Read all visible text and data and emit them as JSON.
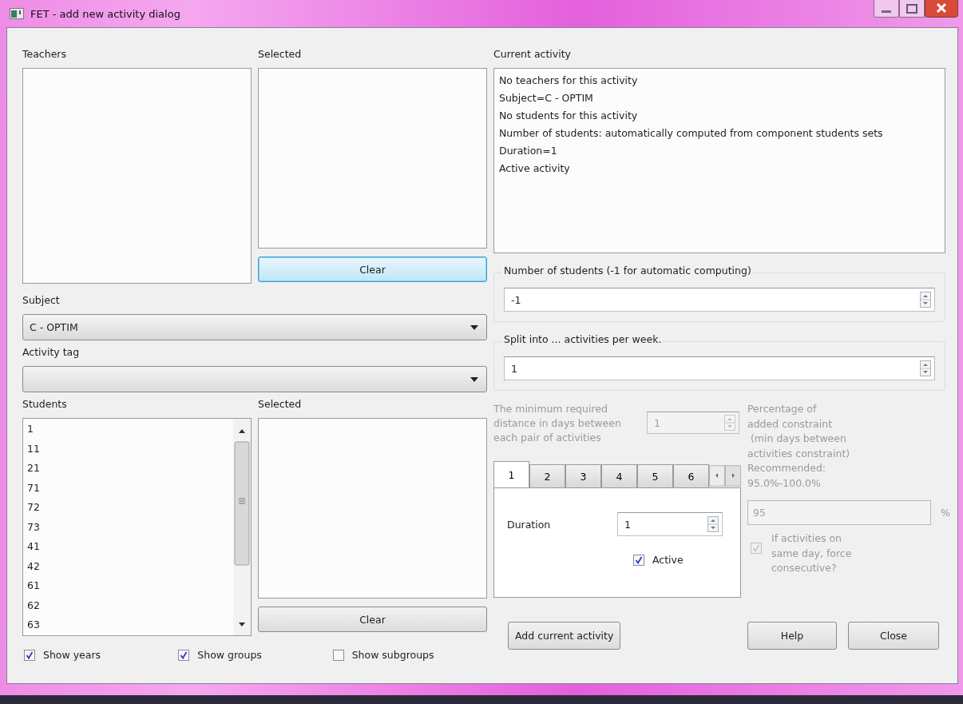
{
  "window": {
    "title": "FET - add new activity dialog"
  },
  "teachers": {
    "label": "Teachers",
    "selected_label": "Selected",
    "clear": "Clear"
  },
  "subject": {
    "label": "Subject",
    "value": "C - OPTIM"
  },
  "activity_tag": {
    "label": "Activity tag"
  },
  "students": {
    "label": "Students",
    "selected_label": "Selected",
    "clear": "Clear",
    "items": [
      "1",
      "11",
      "21",
      "71",
      "72",
      "73",
      "41",
      "42",
      "61",
      "62",
      "63"
    ]
  },
  "show_options": [
    {
      "label": "Show years",
      "checked": true
    },
    {
      "label": "Show groups",
      "checked": true
    },
    {
      "label": "Show subgroups",
      "checked": false
    }
  ],
  "current_activity": {
    "label": "Current activity",
    "lines": [
      "No teachers for this activity",
      "Subject=C - OPTIM",
      "No students for this activity",
      "Number of students: automatically computed from component students sets",
      "Duration=1",
      "Active activity"
    ]
  },
  "number_of_students": {
    "label": "Number of students (-1 for automatic computing)",
    "value": "-1"
  },
  "split": {
    "label": "Split into ... activities per week.",
    "value": "1"
  },
  "min_distance": {
    "label": "The minimum required distance in days between each pair of activities",
    "value": "1",
    "disabled": true
  },
  "tabs": [
    {
      "label": "1",
      "selected": true
    },
    {
      "label": "2",
      "selected": false
    },
    {
      "label": "3",
      "selected": false
    },
    {
      "label": "4",
      "selected": false
    },
    {
      "label": "5",
      "selected": false
    },
    {
      "label": "6",
      "selected": false
    }
  ],
  "tab_page": {
    "duration_label": "Duration",
    "duration": "1",
    "active_label": "Active",
    "active": true
  },
  "percentage": {
    "label": "Percentage of\nadded constraint\n (min days between\nactivities constraint)\nRecommended:\n95.0%-100.0%",
    "value": "95",
    "unit": "%",
    "disabled": true
  },
  "force_consecutive": {
    "label": "If activities on same day, force consecutive?",
    "checked": true,
    "disabled": true
  },
  "buttons": {
    "add": "Add current activity",
    "help": "Help",
    "close": "Close"
  }
}
